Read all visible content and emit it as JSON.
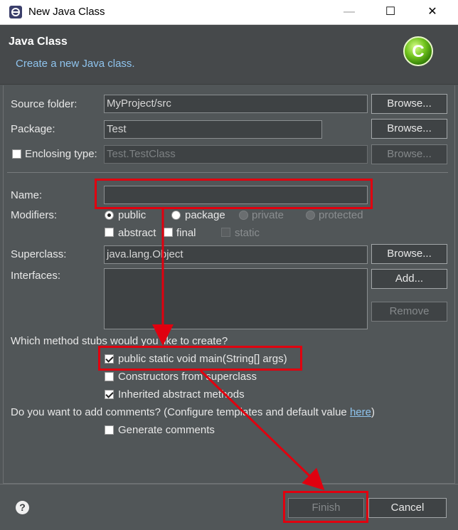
{
  "window": {
    "title": "New Java Class",
    "minimize_glyph": "—",
    "maximize_glyph": "☐",
    "close_glyph": "✕"
  },
  "banner": {
    "title": "Java Class",
    "description": "Create a new Java class.",
    "icon_letter": "C"
  },
  "form": {
    "source_folder": {
      "label": "Source folder:",
      "value": "MyProject/src",
      "button": "Browse..."
    },
    "package": {
      "label": "Package:",
      "value": "Test",
      "button": "Browse..."
    },
    "enclosing_type": {
      "label": "Enclosing type:",
      "value": "Test.TestClass",
      "button": "Browse...",
      "checked": false
    },
    "name": {
      "label": "Name:",
      "value": ""
    },
    "modifiers": {
      "label": "Modifiers:",
      "radios": [
        {
          "label": "public",
          "selected": true,
          "enabled": true
        },
        {
          "label": "package",
          "selected": false,
          "enabled": true
        },
        {
          "label": "private",
          "selected": false,
          "enabled": false
        },
        {
          "label": "protected",
          "selected": false,
          "enabled": false
        }
      ],
      "checks": [
        {
          "label": "abstract",
          "checked": false,
          "enabled": true
        },
        {
          "label": "final",
          "checked": false,
          "enabled": true
        },
        {
          "label": "static",
          "checked": false,
          "enabled": false
        }
      ]
    },
    "superclass": {
      "label": "Superclass:",
      "value": "java.lang.Object",
      "button": "Browse..."
    },
    "interfaces": {
      "label": "Interfaces:",
      "add_button": "Add...",
      "remove_button": "Remove"
    },
    "stubs": {
      "question": "Which method stubs would you like to create?",
      "options": [
        {
          "label": "public static void main(String[] args)",
          "checked": true
        },
        {
          "label": "Constructors from superclass",
          "checked": false
        },
        {
          "label": "Inherited abstract methods",
          "checked": true
        }
      ]
    },
    "comments": {
      "question": "Do you want to add comments? (Configure templates and default value ",
      "link": "here",
      "closing": ")",
      "option": "Generate comments",
      "checked": false
    }
  },
  "footer": {
    "help_glyph": "?",
    "finish_button": "Finish",
    "cancel_button": "Cancel"
  },
  "annotation_color": "#e0000f"
}
